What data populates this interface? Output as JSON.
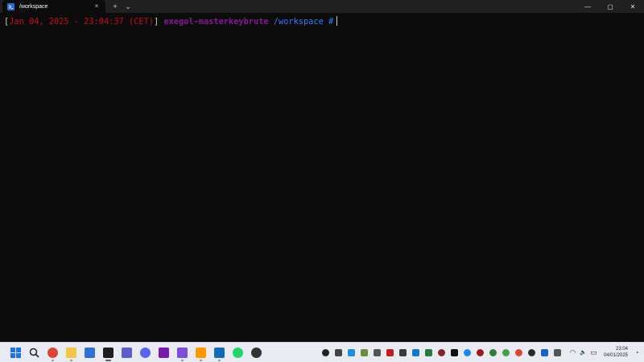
{
  "window": {
    "tab_title": "/workspace",
    "tab_close": "×",
    "new_tab": "+",
    "dropdown": "⌄",
    "minimize": "—",
    "maximize": "▢",
    "close": "✕"
  },
  "terminal": {
    "prompt_open": "[",
    "prompt_datetime": "Jan 04, 2025 - 23:04:37 (CET)",
    "prompt_close": "]",
    "prompt_host": "exegol-masterkeybrute",
    "prompt_path": "/workspace",
    "prompt_symbol": "#"
  },
  "taskbar": {
    "apps": [
      {
        "name": "start-button-icon",
        "color": "#1a73e8"
      },
      {
        "name": "search-icon",
        "color": "#222222"
      },
      {
        "name": "chrome-icon",
        "color": "#db4437"
      },
      {
        "name": "file-explorer-icon",
        "color": "#f4c542"
      },
      {
        "name": "remote-desktop-icon",
        "color": "#2f6fd6"
      },
      {
        "name": "terminal-icon",
        "color": "#1e1e1e"
      },
      {
        "name": "teams-icon",
        "color": "#5b5fc7"
      },
      {
        "name": "discord-icon",
        "color": "#5865f2"
      },
      {
        "name": "onenote-icon",
        "color": "#7719aa"
      },
      {
        "name": "obsidian-icon",
        "color": "#7c4dd6"
      },
      {
        "name": "sublime-text-icon",
        "color": "#ff9800"
      },
      {
        "name": "outlook-icon",
        "color": "#0f6cbd"
      },
      {
        "name": "whatsapp-icon",
        "color": "#25d366"
      },
      {
        "name": "notification-app-icon",
        "color": "#333333"
      }
    ],
    "tray": [
      {
        "name": "tray-app-icon-1",
        "color": "#222222"
      },
      {
        "name": "tray-app-icon-2",
        "color": "#444444"
      },
      {
        "name": "tray-app-icon-3",
        "color": "#1d8fe0"
      },
      {
        "name": "tray-app-icon-4",
        "color": "#6a8f3a"
      },
      {
        "name": "tray-app-icon-5",
        "color": "#555555"
      },
      {
        "name": "tray-app-icon-6",
        "color": "#c02020"
      },
      {
        "name": "tray-app-icon-7",
        "color": "#3a3a3a"
      },
      {
        "name": "onedrive-icon",
        "color": "#0f78d4"
      },
      {
        "name": "tray-app-icon-9",
        "color": "#2a7a3a"
      },
      {
        "name": "tray-app-icon-10",
        "color": "#7a2a2a"
      },
      {
        "name": "x-icon",
        "color": "#111111"
      },
      {
        "name": "tray-app-icon-12",
        "color": "#1e88e5"
      },
      {
        "name": "tray-app-icon-13",
        "color": "#9c1b1b"
      },
      {
        "name": "tray-app-icon-14",
        "color": "#2e7d32"
      },
      {
        "name": "tray-app-icon-15",
        "color": "#43a047"
      },
      {
        "name": "chrome-tray-icon",
        "color": "#db4437"
      },
      {
        "name": "tray-app-icon-17",
        "color": "#2b2b2b"
      },
      {
        "name": "bluetooth-icon",
        "color": "#1565c0"
      },
      {
        "name": "microphone-icon",
        "color": "#555555"
      }
    ],
    "wifi": "◠",
    "volume": "🔈",
    "battery": "▭",
    "time": "23:04",
    "date": "04/01/2025",
    "bell": "◔"
  }
}
